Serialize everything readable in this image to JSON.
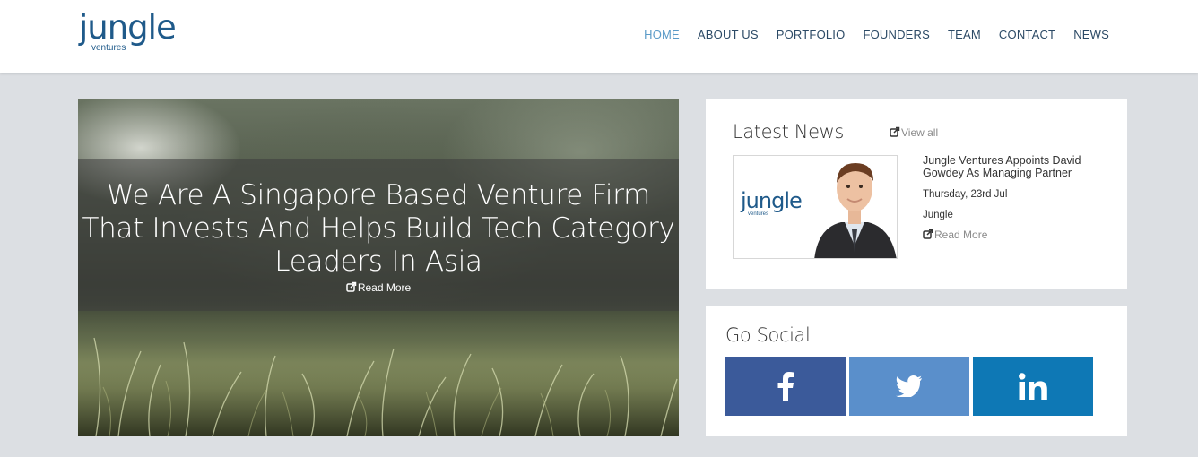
{
  "brand": {
    "name": "jungle",
    "sub": "ventures",
    "color": "#1f5a8a"
  },
  "nav": {
    "items": [
      "HOME",
      "ABOUT US",
      "PORTFOLIO",
      "FOUNDERS",
      "TEAM",
      "CONTACT",
      "NEWS"
    ],
    "active": "HOME"
  },
  "hero": {
    "title": "We Are A Singapore Based Venture Firm That Invests And Helps Build Tech Category Leaders In Asia",
    "read_more": "Read More"
  },
  "latest_news": {
    "title": "Latest News",
    "view_all": "View all",
    "item": {
      "thumb_logo": "jungle",
      "thumb_logo_sub": "ventures",
      "headline": "Jungle Ventures Appoints David Gowdey As Managing Partner",
      "date": "Thursday, 23rd Jul",
      "source": "Jungle",
      "read_more": "Read More"
    }
  },
  "social": {
    "title": "Go Social",
    "buttons": [
      {
        "network": "facebook",
        "icon": "facebook-icon",
        "color": "#3b5a9a"
      },
      {
        "network": "twitter",
        "icon": "twitter-icon",
        "color": "#5a8fcb"
      },
      {
        "network": "linkedin",
        "icon": "linkedin-icon",
        "color": "#0e78b5"
      }
    ]
  }
}
